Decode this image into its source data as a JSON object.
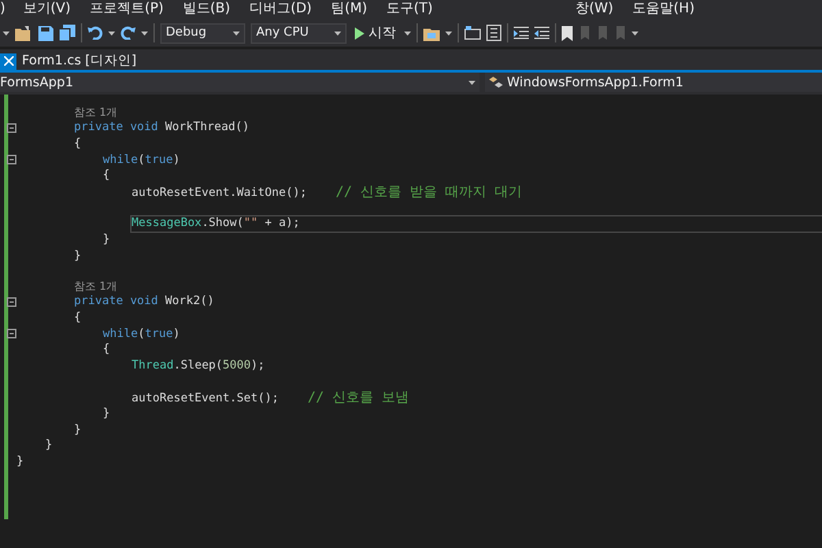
{
  "menu": [
    {
      "label": ")"
    },
    {
      "label": "보기(V)"
    },
    {
      "label": "프로젝트(P)"
    },
    {
      "label": "빌드(B)"
    },
    {
      "label": "디버그(D)"
    },
    {
      "label": "팀(M)"
    },
    {
      "label": "도구(T)"
    },
    {
      "label": "창(W)"
    },
    {
      "label": "도움말(H)"
    }
  ],
  "toolbar": {
    "configuration": "Debug",
    "platform": "Any CPU",
    "start": "시작"
  },
  "tab": {
    "label": "Form1.cs [디자인]"
  },
  "navigation": {
    "project": "FormsApp1",
    "type": "WindowsFormsApp1.Form1"
  },
  "editor": {
    "lines": [
      {
        "kind": "scope",
        "children": [
          {
            "kind": "scope",
            "children": [
              {
                "kind": "codelens",
                "text": "참조 1개"
              },
              {
                "kind": "code",
                "foldable": true,
                "current": false,
                "tokens": [
                  {
                    "text": "private void",
                    "kind": "keyword"
                  },
                  {
                    "text": " WorkThread()",
                    "kind": "plain"
                  }
                ]
              },
              {
                "kind": "code",
                "foldable": false,
                "current": false,
                "tokens": [
                  {
                    "text": "{",
                    "kind": "plain"
                  }
                ],
                "children": [
                  {
                    "kind": "code",
                    "foldable": true,
                    "current": false,
                    "tokens": [
                      {
                        "text": "while",
                        "kind": "keyword"
                      },
                      {
                        "text": "(",
                        "kind": "plain"
                      },
                      {
                        "text": "true",
                        "kind": "keyword"
                      },
                      {
                        "text": ")",
                        "kind": "plain"
                      }
                    ]
                  },
                  {
                    "kind": "code",
                    "foldable": false,
                    "current": false,
                    "tokens": [
                      {
                        "text": "{",
                        "kind": "plain"
                      }
                    ],
                    "children": [
                      {
                        "kind": "code",
                        "foldable": false,
                        "current": false,
                        "tokens": [
                          {
                            "text": "autoResetEvent.WaitOne();",
                            "kind": "plain"
                          },
                          {
                            "text": "// 신호를 받을 때까지 대기",
                            "kind": "comment"
                          }
                        ]
                      },
                      {
                        "kind": "blank"
                      },
                      {
                        "kind": "code",
                        "foldable": false,
                        "current": true,
                        "tokens": [
                          {
                            "text": "MessageBox",
                            "kind": "type"
                          },
                          {
                            "text": ".Show(",
                            "kind": "plain"
                          },
                          {
                            "text": "\"\"",
                            "kind": "string"
                          },
                          {
                            "text": " + a);",
                            "kind": "plain"
                          }
                        ]
                      }
                    ]
                  },
                  {
                    "kind": "code",
                    "foldable": false,
                    "current": false,
                    "tokens": [
                      {
                        "text": "}",
                        "kind": "plain"
                      }
                    ]
                  }
                ]
              },
              {
                "kind": "code",
                "foldable": false,
                "current": false,
                "tokens": [
                  {
                    "text": "}",
                    "kind": "plain"
                  }
                ]
              },
              {
                "kind": "blank"
              },
              {
                "kind": "codelens",
                "text": "참조 1개"
              },
              {
                "kind": "code",
                "foldable": true,
                "current": false,
                "tokens": [
                  {
                    "text": "private void",
                    "kind": "keyword"
                  },
                  {
                    "text": " Work2()",
                    "kind": "plain"
                  }
                ]
              },
              {
                "kind": "code",
                "foldable": false,
                "current": false,
                "tokens": [
                  {
                    "text": "{",
                    "kind": "plain"
                  }
                ],
                "children": [
                  {
                    "kind": "code",
                    "foldable": true,
                    "current": false,
                    "tokens": [
                      {
                        "text": "while",
                        "kind": "keyword"
                      },
                      {
                        "text": "(",
                        "kind": "plain"
                      },
                      {
                        "text": "true",
                        "kind": "keyword"
                      },
                      {
                        "text": ")",
                        "kind": "plain"
                      }
                    ]
                  },
                  {
                    "kind": "code",
                    "foldable": false,
                    "current": false,
                    "tokens": [
                      {
                        "text": "{",
                        "kind": "plain"
                      }
                    ],
                    "children": [
                      {
                        "kind": "code",
                        "foldable": false,
                        "current": false,
                        "tokens": [
                          {
                            "text": "Thread",
                            "kind": "type"
                          },
                          {
                            "text": ".Sleep(",
                            "kind": "plain"
                          },
                          {
                            "text": "5000",
                            "kind": "number"
                          },
                          {
                            "text": ");",
                            "kind": "plain"
                          }
                        ]
                      },
                      {
                        "kind": "blank"
                      },
                      {
                        "kind": "code",
                        "foldable": false,
                        "current": false,
                        "tokens": [
                          {
                            "text": "autoResetEvent.Set();",
                            "kind": "plain"
                          },
                          {
                            "text": "// 신호를 보냄",
                            "kind": "comment"
                          }
                        ]
                      }
                    ]
                  },
                  {
                    "kind": "code",
                    "foldable": false,
                    "current": false,
                    "tokens": [
                      {
                        "text": "}",
                        "kind": "plain"
                      }
                    ]
                  }
                ]
              },
              {
                "kind": "code",
                "foldable": false,
                "current": false,
                "tokens": [
                  {
                    "text": "}",
                    "kind": "plain"
                  }
                ]
              }
            ]
          },
          {
            "kind": "code",
            "foldable": false,
            "current": false,
            "tokens": [
              {
                "text": "}",
                "kind": "plain"
              }
            ]
          }
        ]
      },
      {
        "kind": "code",
        "foldable": false,
        "current": false,
        "tokens": [
          {
            "text": "}",
            "kind": "plain"
          }
        ]
      }
    ]
  }
}
